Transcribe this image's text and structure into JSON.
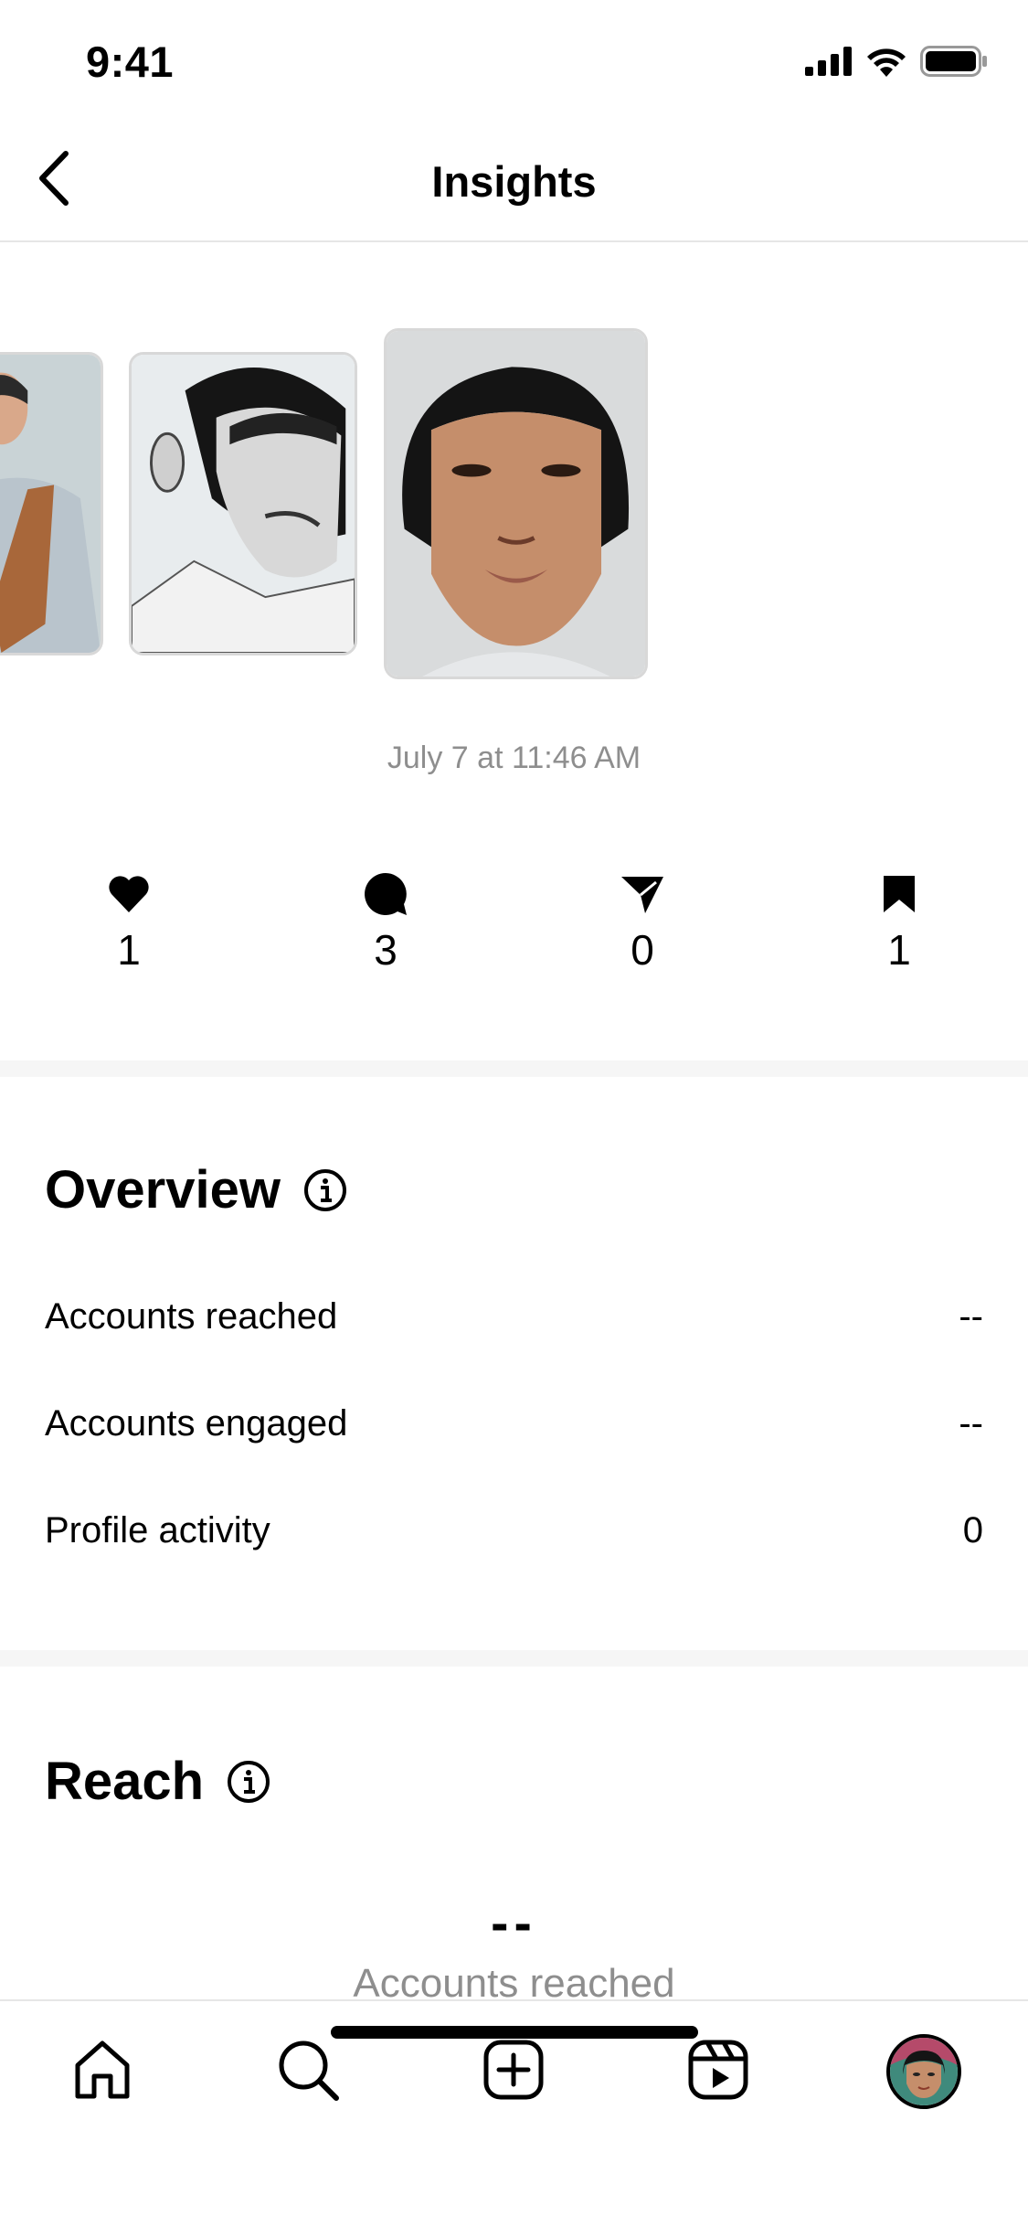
{
  "status_bar": {
    "time": "9:41",
    "icons": [
      "signal-icon",
      "wifi-icon",
      "battery-icon"
    ]
  },
  "nav": {
    "title": "Insights",
    "back_icon": "chevron-left-icon"
  },
  "post": {
    "date": "July 7 at 11:46 AM",
    "thumbnails": [
      "carousel-thumb-1",
      "carousel-thumb-2",
      "carousel-thumb-3"
    ]
  },
  "stats": {
    "likes": "1",
    "comments": "3",
    "shares": "0",
    "saves": "1"
  },
  "overview": {
    "title": "Overview",
    "rows": [
      {
        "label": "Accounts reached",
        "value": "--"
      },
      {
        "label": "Accounts engaged",
        "value": "--"
      },
      {
        "label": "Profile activity",
        "value": "0"
      }
    ]
  },
  "reach": {
    "title": "Reach",
    "value": "--",
    "label": "Accounts reached"
  },
  "tab_bar": {
    "items": [
      "home-icon",
      "search-icon",
      "create-icon",
      "reels-icon",
      "profile-avatar"
    ]
  },
  "colors": {
    "text": "#000000",
    "muted": "#8e8e8e",
    "divider": "#e6e6e6",
    "section_bg": "#f6f6f6"
  }
}
